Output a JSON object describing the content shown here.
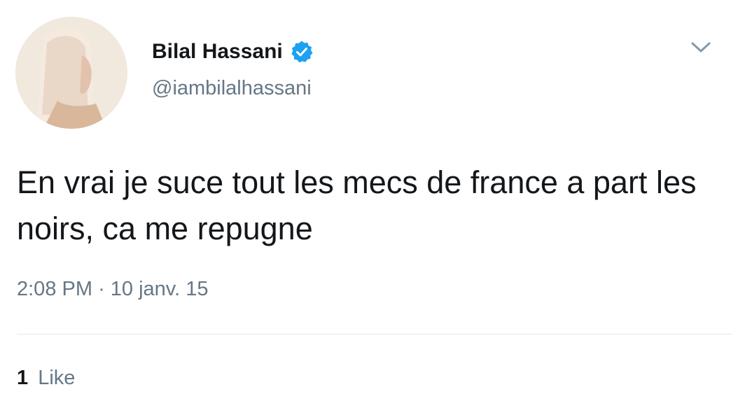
{
  "user": {
    "display_name": "Bilal Hassani",
    "handle": "@iambilalhassani",
    "verified": true,
    "avatar_icon": "profile-photo"
  },
  "tweet": {
    "text": "En vrai je suce tout les mecs de france a part les noirs, ca me repugne",
    "time": "2:08 PM",
    "separator": "·",
    "date": "10 janv. 15"
  },
  "stats": {
    "likes_count": "1",
    "likes_label": "Like"
  },
  "icons": {
    "verified": "verified-badge-icon",
    "menu": "chevron-down-icon"
  },
  "colors": {
    "verified_blue": "#1da1f2",
    "secondary_text": "#657786",
    "primary_text": "#14171a",
    "divider": "#e1e8ed"
  }
}
